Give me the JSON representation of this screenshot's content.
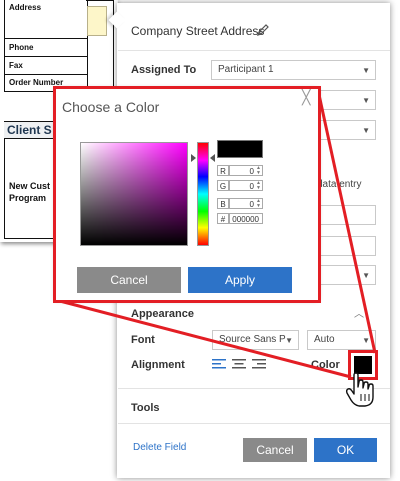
{
  "document": {
    "fields": [
      "Address",
      "Phone",
      "Fax",
      "Order Number"
    ],
    "section_heading": "Client S",
    "new_customer_line1": "New Cust",
    "new_customer_line2": "Program"
  },
  "panel": {
    "field_name": "Company Street Address",
    "assigned_to_label": "Assigned To",
    "assigned_to_value": "Participant 1",
    "partial_option": "data entry",
    "appearance_label": "Appearance",
    "font_label": "Font",
    "font_value": "Source Sans P",
    "font_size_value": "Auto",
    "alignment_label": "Alignment",
    "color_label": "Color",
    "color_value": "#000000",
    "tools_label": "Tools",
    "delete_label": "Delete Field",
    "cancel_label": "Cancel",
    "ok_label": "OK"
  },
  "color_picker": {
    "title": "Choose a Color",
    "close_glyph": "╳",
    "r_label": "R",
    "r_value": "0",
    "g_label": "G",
    "g_value": "0",
    "b_label": "B",
    "b_value": "0",
    "hex_label": "#",
    "hex_value": "000000",
    "cancel_label": "Cancel",
    "apply_label": "Apply"
  },
  "colors": {
    "accent_red": "#e31e24",
    "primary_blue": "#2d73c8",
    "button_gray": "#8a8a8a"
  }
}
